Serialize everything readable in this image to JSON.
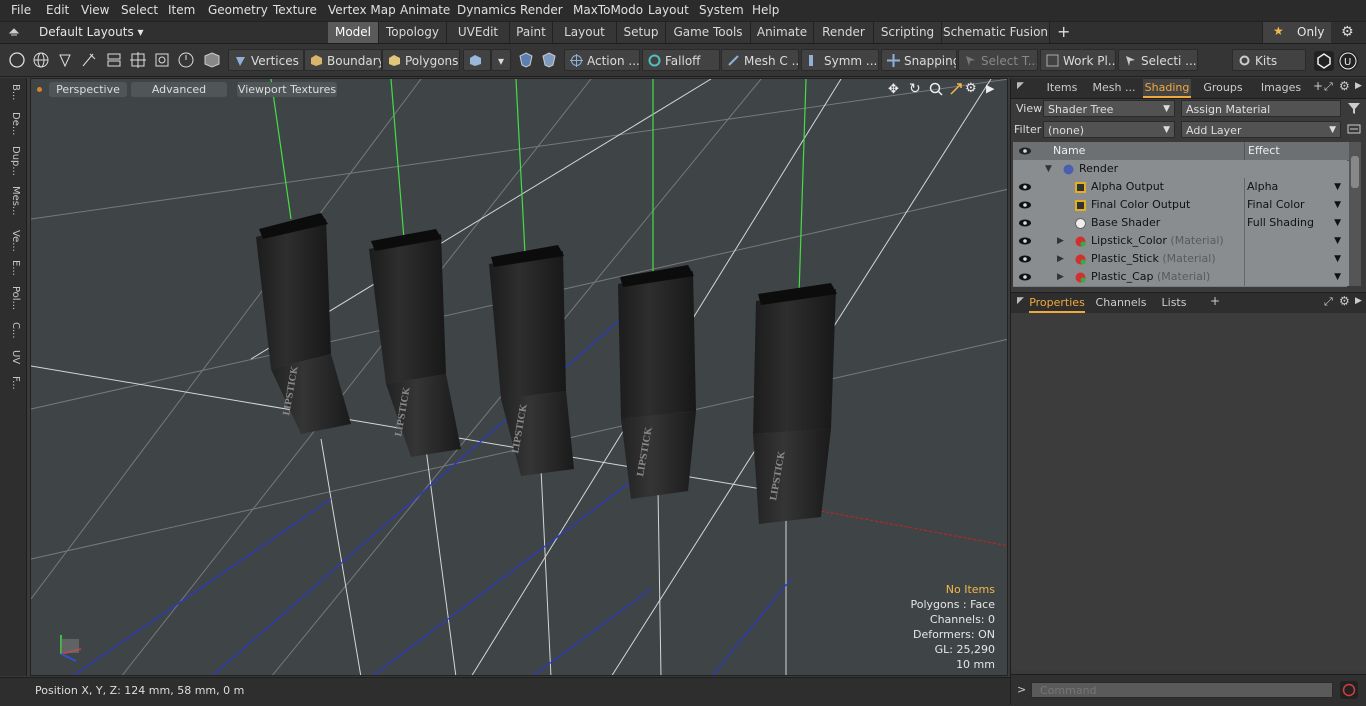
{
  "menu": [
    "File",
    "Edit",
    "View",
    "Select",
    "Item",
    "Geometry",
    "Texture",
    "Vertex Map",
    "Animate",
    "Dynamics",
    "Render",
    "MaxToModo",
    "Layout",
    "System",
    "Help"
  ],
  "layout_selector": "Default Layouts ▾",
  "tabs": [
    "Model",
    "Topology",
    "UVEdit",
    "Paint",
    "Layout",
    "Setup",
    "Game Tools",
    "Animate",
    "Render",
    "Scripting",
    "Schematic Fusion"
  ],
  "tab_add": "+",
  "only_label": "Only",
  "toolbar": {
    "vertices": "Vertices",
    "boundary": "Boundary",
    "polygons": "Polygons",
    "action": "Action ...",
    "falloff": "Falloff",
    "mesh_c": "Mesh C ...",
    "symm": "Symm ...",
    "snapping": "Snapping",
    "select_t": "Select T...",
    "work_pl": "Work Pl...",
    "selecti": "Selecti ...",
    "kits": "Kits"
  },
  "left_strip": [
    "B...",
    "De...",
    "Dup...",
    "Mes...",
    "Ve...",
    "E...",
    "Pol...",
    "C...",
    "UV",
    "F..."
  ],
  "viewport": {
    "perspective": "Perspective",
    "advanced": "Advanced",
    "viewport_textures": "Viewport Textures",
    "info": {
      "no_items": "No Items",
      "polygons": "Polygons : Face",
      "channels": "Channels: 0",
      "deformers": "Deformers: ON",
      "gl": "GL: 25,290",
      "scale": "10 mm"
    },
    "label_text": "LIPSTICK",
    "colors": {
      "bg": "#3f4447",
      "grid": "#c8c8c8",
      "axis_x": "#d02020",
      "axis_z": "#2030c0",
      "highlight": "#44dd44",
      "info_accent": "#f2b84b"
    }
  },
  "status": {
    "position": "Position X, Y, Z:   124 mm, 58 mm, 0 m"
  },
  "right_panel": {
    "tabs": [
      "Items",
      "Mesh ...",
      "Shading",
      "Groups",
      "Images"
    ],
    "view_label": "View",
    "view_value": "Shader Tree",
    "assign_material": "Assign Material",
    "filter_label": "Filter",
    "filter_value": "(none)",
    "add_layer": "Add Layer",
    "col_name": "Name",
    "col_effect": "Effect",
    "rows": [
      {
        "name": "Render",
        "sub": "",
        "effect": ""
      },
      {
        "name": "Alpha Output",
        "sub": "",
        "effect": "Alpha"
      },
      {
        "name": "Final Color Output",
        "sub": "",
        "effect": "Final Color"
      },
      {
        "name": "Base Shader",
        "sub": "",
        "effect": "Full Shading"
      },
      {
        "name": "Lipstick_Color",
        "sub": "(Material)",
        "effect": ""
      },
      {
        "name": "Plastic_Stick",
        "sub": "(Material)",
        "effect": ""
      },
      {
        "name": "Plastic_Cap",
        "sub": "(Material)",
        "effect": ""
      }
    ],
    "bottom_tabs": [
      "Properties",
      "Channels",
      "Lists"
    ],
    "command_placeholder": "Command"
  }
}
